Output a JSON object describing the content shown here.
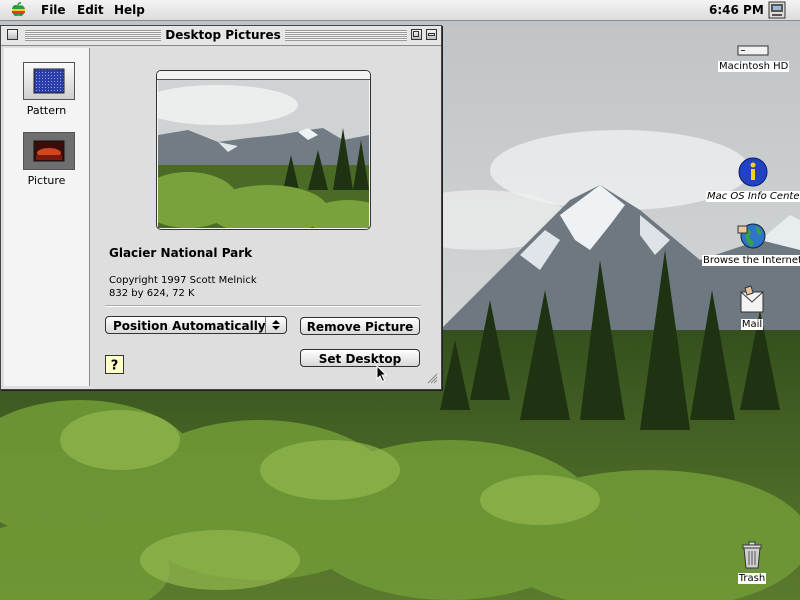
{
  "menubar": {
    "items": [
      {
        "label": "File"
      },
      {
        "label": "Edit"
      },
      {
        "label": "Help"
      }
    ],
    "clock": "6:46 PM",
    "apple_icon": "apple-icon",
    "switcher_icon": "application-switcher-icon"
  },
  "window": {
    "title": "Desktop Pictures",
    "categories": [
      {
        "label": "Pattern",
        "icon": "pattern-icon"
      },
      {
        "label": "Picture",
        "icon": "picture-icon",
        "selected": true
      }
    ],
    "picture": {
      "title": "Glacier National Park",
      "copyright": "Copyright 1997 Scott Melnick",
      "info": "832 by 624, 72 K"
    },
    "position_popup": {
      "selected": "Position Automatically"
    },
    "buttons": {
      "remove": "Remove Picture",
      "set_desktop": "Set Desktop",
      "help": "?"
    }
  },
  "desktop_icons": [
    {
      "label": "Macintosh HD",
      "icon": "hard-disk-icon"
    },
    {
      "label": "Mac OS Info Center",
      "icon": "info-center-icon"
    },
    {
      "label": "Browse the Internet",
      "icon": "internet-globe-icon"
    },
    {
      "label": "Mail",
      "icon": "mail-icon"
    },
    {
      "label": "Trash",
      "icon": "trash-icon"
    }
  ],
  "colors": {
    "sky": "#cfd3d4",
    "forest": "#3f5a23",
    "mountain": "#6e7880"
  }
}
